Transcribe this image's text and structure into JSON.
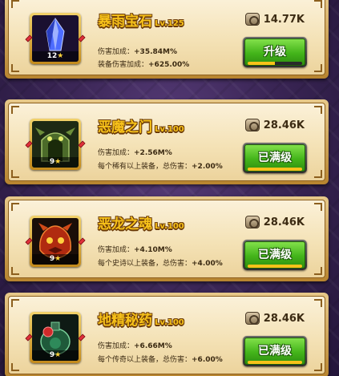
{
  "artifacts": [
    {
      "name": "暴雨宝石",
      "level": "Lv.125",
      "stars": "12",
      "stat1_label": "伤害加成：",
      "stat1_value": "+35.84M%",
      "stat2_label": "装备伤害加成：",
      "stat2_value": "+625.00%",
      "cost": "14.77K",
      "button_label": "升级",
      "progress": 0.5,
      "icon": "blue-crystal-icon"
    },
    {
      "name": "恶魔之门",
      "level": "Lv.100",
      "stars": "9",
      "stat1_label": "伤害加成：",
      "stat1_value": "+2.56M%",
      "stat2_label": "每个稀有以上装备，总伤害：",
      "stat2_value": "+2.00%",
      "cost": "28.46K",
      "button_label": "已满级",
      "progress": 1,
      "icon": "demon-gate-icon"
    },
    {
      "name": "恶龙之魂",
      "level": "Lv.100",
      "stars": "9",
      "stat1_label": "伤害加成：",
      "stat1_value": "+4.10M%",
      "stat2_label": "每个史诗以上装备，总伤害：",
      "stat2_value": "+4.00%",
      "cost": "28.46K",
      "button_label": "已满级",
      "progress": 1,
      "icon": "dragon-soul-icon"
    },
    {
      "name": "地精秘药",
      "level": "Lv.100",
      "stars": "9",
      "stat1_label": "伤害加成：",
      "stat1_value": "+6.66M%",
      "stat2_label": "每个传奇以上装备，总伤害：",
      "stat2_value": "+6.00%",
      "cost": "28.46K",
      "button_label": "已满级",
      "progress": 1,
      "icon": "goblin-potion-icon"
    }
  ],
  "colors": {
    "title": "#f7c21a",
    "button_green": "#43b41a",
    "card_bg": "#f4e2b6",
    "background": "#3b2656"
  }
}
